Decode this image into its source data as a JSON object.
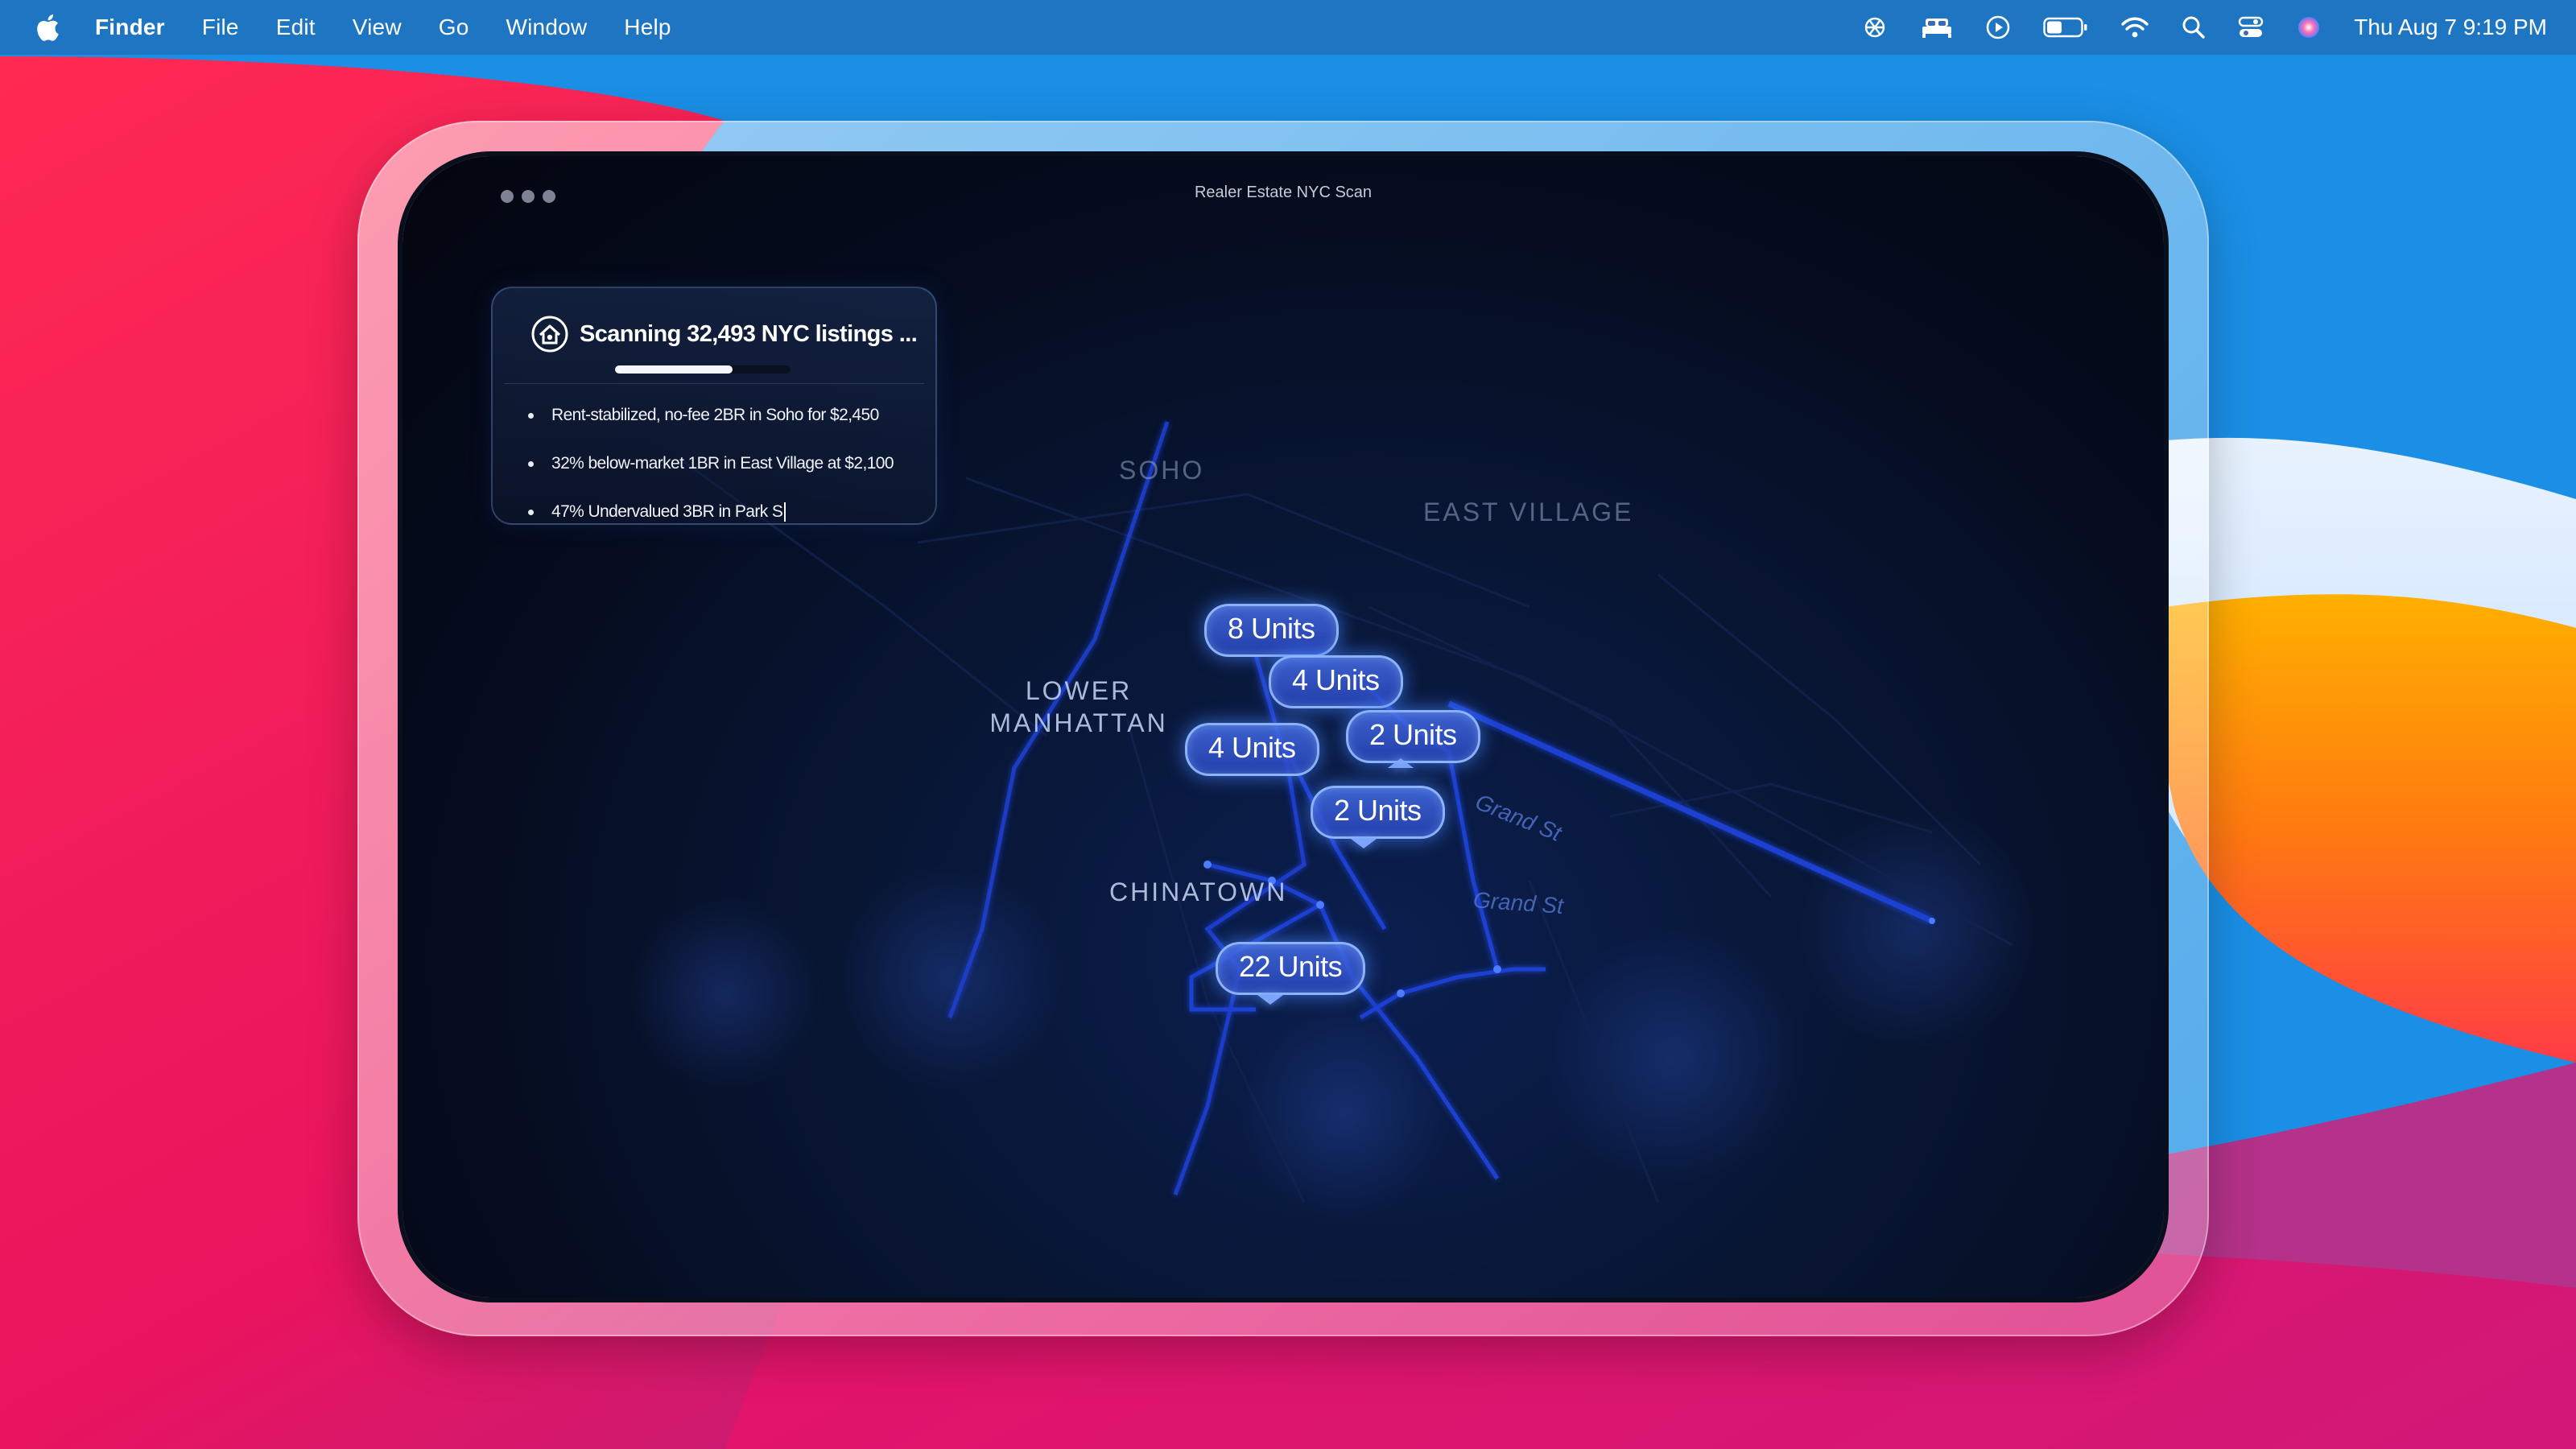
{
  "menubar": {
    "app_name": "Finder",
    "menus": [
      "File",
      "Edit",
      "View",
      "Go",
      "Window",
      "Help"
    ],
    "status_icons": [
      "chatgpt-icon",
      "bed-icon",
      "play-icon",
      "battery-icon",
      "wifi-icon",
      "search-icon",
      "control-center-icon",
      "siri-icon"
    ],
    "clock": "Thu Aug 7  9:19 PM"
  },
  "window": {
    "title": "Realer Estate NYC Scan"
  },
  "scan_panel": {
    "title": "Scanning 32,493 NYC listings ...",
    "progress": 0.67,
    "results": [
      "Rent-stabilized, no-fee 2BR in Soho for $2,450",
      "32% below-market 1BR in East Village at $2,100",
      "47% Undervalued 3BR in Park S"
    ]
  },
  "map": {
    "neighborhoods": {
      "soho": "SOHO",
      "east_village": "EAST VILLAGE",
      "lower_manhattan_1": "LOWER",
      "lower_manhattan_2": "MANHATTAN",
      "chinatown": "CHINATOWN"
    },
    "streets": {
      "grand_st_1": "Grand St",
      "grand_st_2": "Grand St"
    },
    "pins": [
      {
        "label": "8 Units"
      },
      {
        "label": "4 Units"
      },
      {
        "label": "2 Units"
      },
      {
        "label": "4 Units"
      },
      {
        "label": "2 Units"
      },
      {
        "label": "22 Units"
      }
    ]
  },
  "colors": {
    "accent": "#3f6fe8",
    "glow": "#6fa0ff",
    "screen_bg": "#050b1d"
  }
}
